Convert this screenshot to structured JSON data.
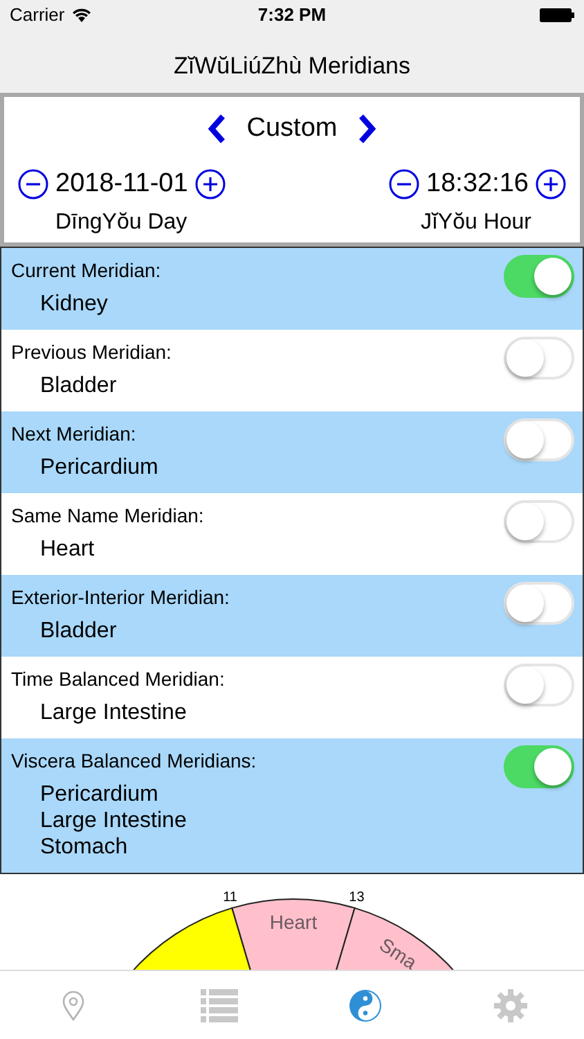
{
  "status_bar": {
    "carrier": "Carrier",
    "time": "7:32 PM"
  },
  "nav_bar": {
    "title": "ZĭWŭLiúZhù Meridians"
  },
  "selector": {
    "mode": "Custom",
    "date": "2018-11-01",
    "day_name": "DīngYŏu Day",
    "time": "18:32:16",
    "hour_name": "JĭYŏu Hour"
  },
  "meridians": [
    {
      "label": "Current Meridian:",
      "on": true,
      "values": [
        "Kidney"
      ]
    },
    {
      "label": "Previous Meridian:",
      "on": false,
      "values": [
        "Bladder"
      ]
    },
    {
      "label": "Next Meridian:",
      "on": false,
      "values": [
        "Pericardium"
      ]
    },
    {
      "label": "Same Name Meridian:",
      "on": false,
      "values": [
        "Heart"
      ]
    },
    {
      "label": "Exterior-Interior Meridian:",
      "on": false,
      "values": [
        "Bladder"
      ]
    },
    {
      "label": "Time Balanced Meridian:",
      "on": false,
      "values": [
        "Large Intestine"
      ]
    },
    {
      "label": "Viscera Balanced Meridians:",
      "on": true,
      "values": [
        "Pericardium",
        "Large Intestine",
        "Stomach"
      ]
    }
  ],
  "wheel": {
    "ticks": [
      "11",
      "13"
    ],
    "sectors": [
      {
        "color": "#ffff00"
      },
      {
        "label": "Heart",
        "color": "#ffc0cb"
      },
      {
        "label": "Sma",
        "color": "#ffc0cb"
      }
    ]
  },
  "tab_bar": [
    {
      "kind": "location",
      "selected": false
    },
    {
      "kind": "list",
      "selected": false
    },
    {
      "kind": "yinyang",
      "selected": true
    },
    {
      "kind": "settings",
      "selected": false
    }
  ]
}
